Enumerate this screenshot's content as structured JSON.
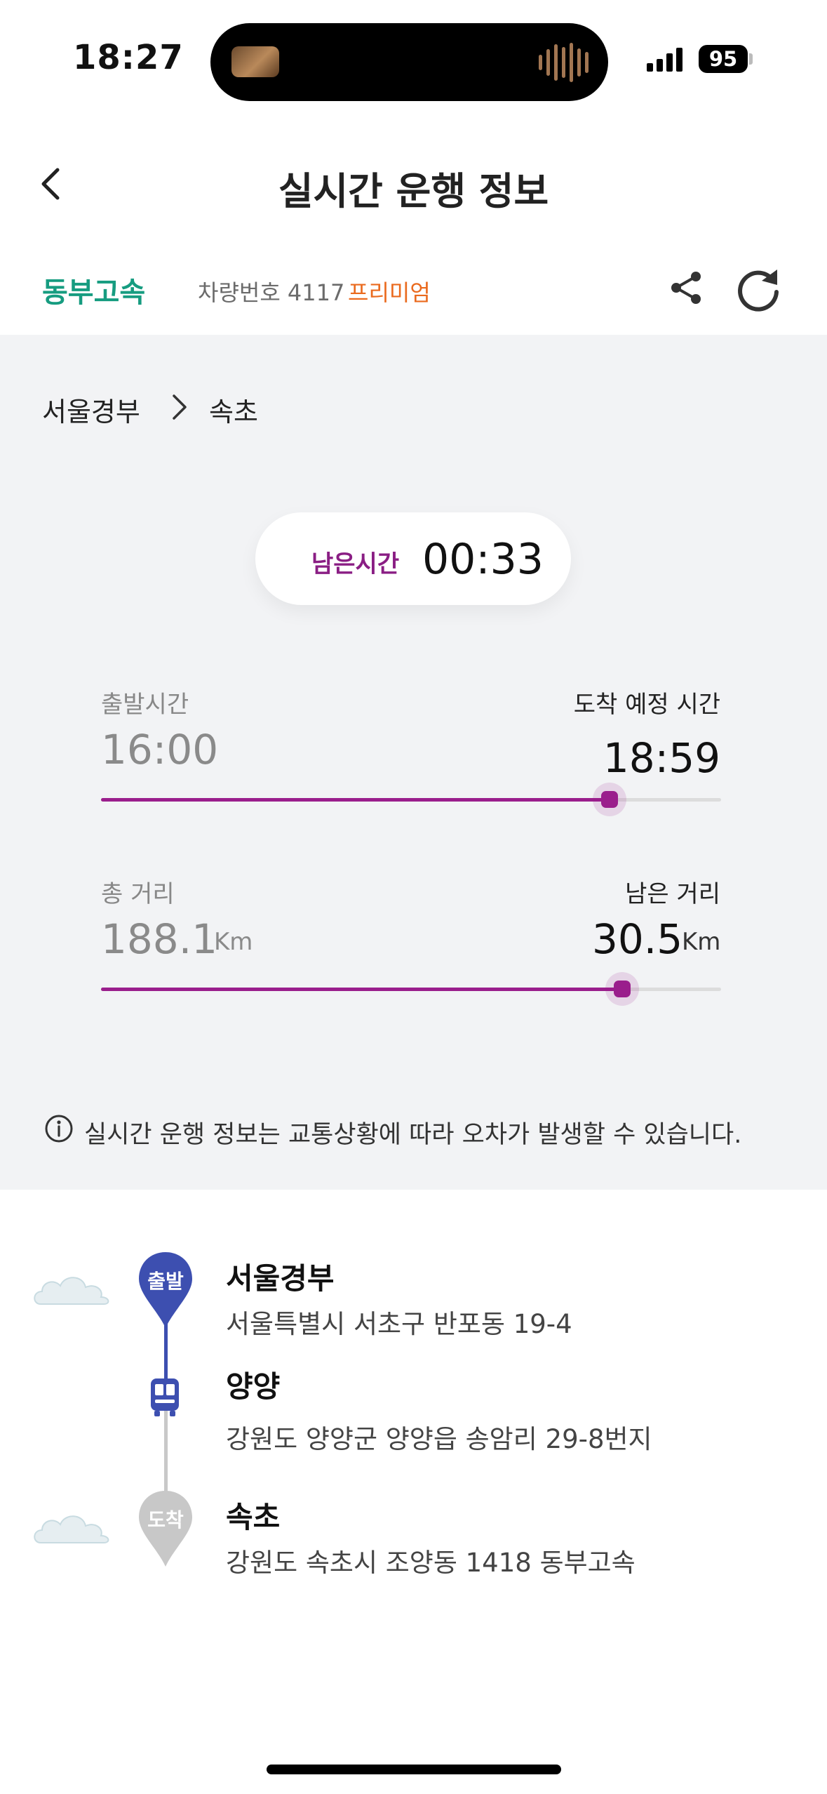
{
  "status_bar": {
    "time": "18:27",
    "battery": "95"
  },
  "header": {
    "title": "실시간 운행 정보"
  },
  "operator": {
    "company": "동부고속",
    "vehicle": "차량번호 4117",
    "grade": "프리미엄"
  },
  "route": {
    "from": "서울경부",
    "to": "속초"
  },
  "remaining_time": {
    "label": "남은시간",
    "value": "00:33"
  },
  "time_progress": {
    "departure_label": "출발시간",
    "departure": "16:00",
    "arrival_label": "도착 예정 시간",
    "arrival": "18:59",
    "progress": 0.82
  },
  "distance_progress": {
    "total_label": "총 거리",
    "total": "188.1",
    "total_unit": "Km",
    "remaining_label": "남은 거리",
    "remaining": "30.5",
    "remaining_unit": "Km",
    "progress": 0.84
  },
  "notice": "실시간 운행 정보는 교통상황에 따라 오차가 발생할 수 있습니다.",
  "stops": [
    {
      "badge": "출발",
      "name": "서울경부",
      "address": "서울특별시 서초구 반포동 19-4"
    },
    {
      "name": "양양",
      "address": "강원도 양양군 양양읍 송암리 29-8번지"
    },
    {
      "badge": "도착",
      "name": "속초",
      "address": "강원도 속초시 조양동 1418 동부고속"
    }
  ],
  "colors": {
    "accent": "#9a1e8c",
    "company": "#169c80",
    "premium": "#ea6a1e",
    "departure_pin": "#3d4fb0",
    "arrival_pin": "#c8c8c8"
  }
}
